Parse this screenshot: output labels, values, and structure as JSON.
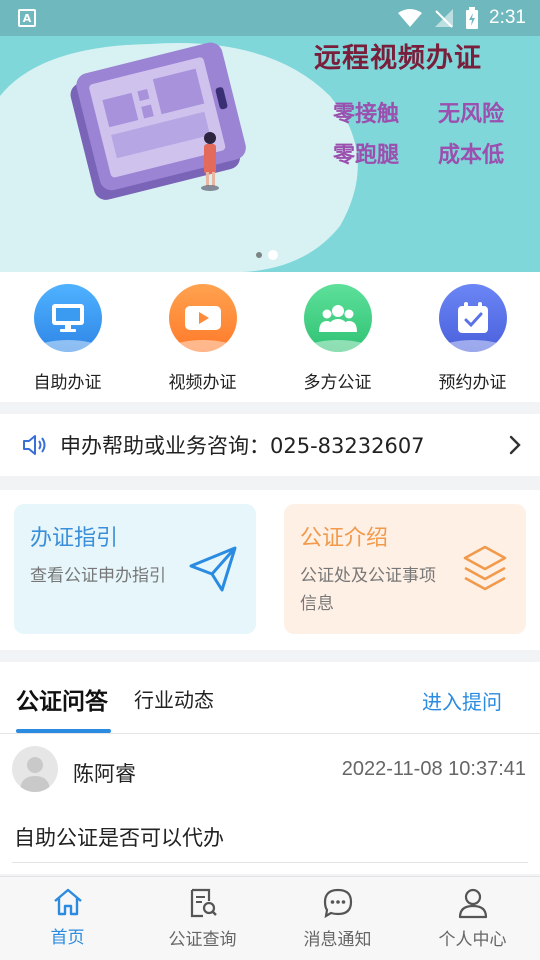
{
  "status_bar": {
    "time": "2:31",
    "app_badge": "A"
  },
  "banner": {
    "title": "远程视频办证",
    "slogans": [
      "零接触",
      "无风险",
      "零跑腿",
      "成本低"
    ],
    "page_count": 2,
    "active_page": 2
  },
  "quick_actions": [
    {
      "label": "自助办证",
      "icon": "monitor-icon",
      "color": "#3a9bf0"
    },
    {
      "label": "视频办证",
      "icon": "video-camera-icon",
      "color": "#ff8a3a"
    },
    {
      "label": "多方公证",
      "icon": "group-icon",
      "color": "#3ccf82"
    },
    {
      "label": "预约办证",
      "icon": "calendar-check-icon",
      "color": "#5a72e8"
    }
  ],
  "consult": {
    "text": "申办帮助或业务咨询：025-83232607"
  },
  "cards": {
    "guide": {
      "title": "办证指引",
      "desc": "查看公证申办指引"
    },
    "intro": {
      "title": "公证介绍",
      "desc": "公证处及公证事项信息"
    }
  },
  "qa": {
    "tabs": [
      "公证问答",
      "行业动态"
    ],
    "active_tab": "公证问答",
    "ask_label": "进入提问",
    "post": {
      "user": "陈阿睿",
      "time": "2022-11-08 10:37:41",
      "question": "自助公证是否可以代办"
    }
  },
  "bottom_nav": [
    {
      "label": "首页",
      "icon": "home-icon",
      "active": true
    },
    {
      "label": "公证查询",
      "icon": "document-search-icon",
      "active": false
    },
    {
      "label": "消息通知",
      "icon": "chat-bubble-icon",
      "active": false
    },
    {
      "label": "个人中心",
      "icon": "user-icon",
      "active": false
    }
  ],
  "colors": {
    "accent": "#2a8be0",
    "banner_bg": "#7fd7d9",
    "title": "#7a1f3b",
    "slogan": "#9b4fae"
  }
}
